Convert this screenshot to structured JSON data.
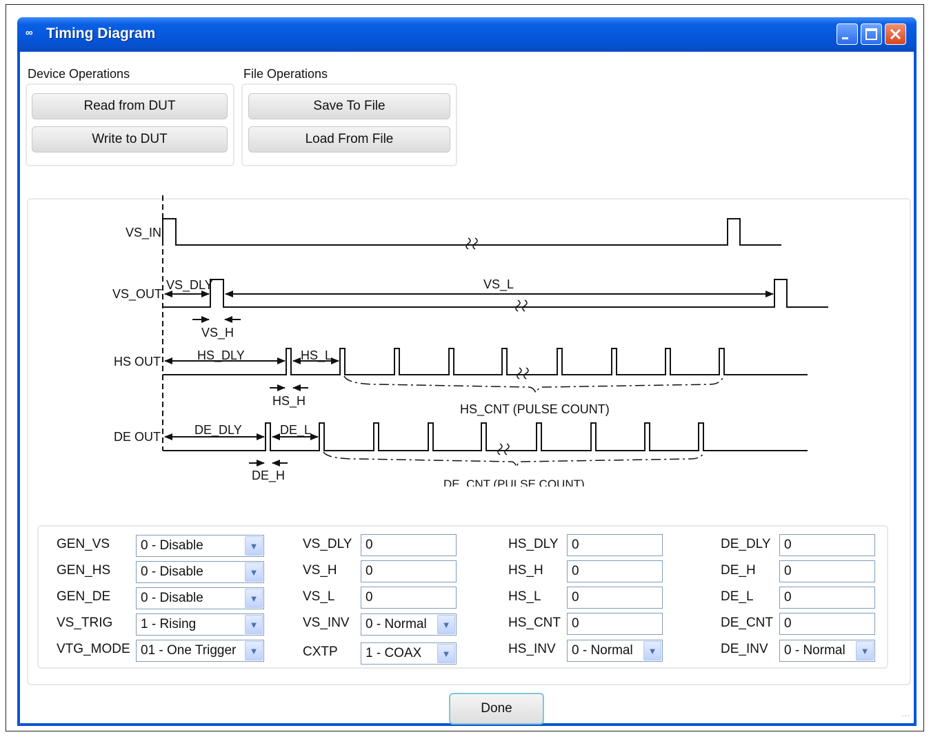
{
  "window": {
    "title": "Timing Diagram",
    "icon": "maxim-logo-icon"
  },
  "device_ops": {
    "label": "Device Operations",
    "read": "Read from DUT",
    "write": "Write to DUT"
  },
  "file_ops": {
    "label": "File Operations",
    "save": "Save To File",
    "load": "Load From File"
  },
  "diagram": {
    "signals": [
      "VS_IN",
      "VS_OUT",
      "HS OUT",
      "DE OUT"
    ],
    "labels": {
      "vs_dly": "VS_DLY",
      "vs_l": "VS_L",
      "vs_h": "VS_H",
      "hs_dly": "HS_DLY",
      "hs_l": "HS_L",
      "hs_h": "HS_H",
      "hs_cnt": "HS_CNT (PULSE COUNT)",
      "de_dly": "DE_DLY",
      "de_l": "DE_L",
      "de_h": "DE_H",
      "de_cnt": "DE_CNT (PULSE COUNT)"
    }
  },
  "params": {
    "col1": [
      {
        "label": "GEN_VS",
        "value": "0 - Disable"
      },
      {
        "label": "GEN_HS",
        "value": "0 - Disable"
      },
      {
        "label": "GEN_DE",
        "value": "0 - Disable"
      },
      {
        "label": "VS_TRIG",
        "value": "1 - Rising"
      },
      {
        "label": "VTG_MODE",
        "value": "01 - One Trigger"
      }
    ],
    "col2": [
      {
        "label": "VS_DLY",
        "value": "0"
      },
      {
        "label": "VS_H",
        "value": "0"
      },
      {
        "label": "VS_L",
        "value": "0"
      },
      {
        "label": "VS_INV",
        "value": "0 - Normal"
      },
      {
        "label": "CXTP",
        "value": "1 - COAX"
      }
    ],
    "col3": [
      {
        "label": "HS_DLY",
        "value": "0"
      },
      {
        "label": "HS_H",
        "value": "0"
      },
      {
        "label": "HS_L",
        "value": "0"
      },
      {
        "label": "HS_CNT",
        "value": "0"
      },
      {
        "label": "HS_INV",
        "value": "0 - Normal"
      }
    ],
    "col4": [
      {
        "label": "DE_DLY",
        "value": "0"
      },
      {
        "label": "DE_H",
        "value": "0"
      },
      {
        "label": "DE_L",
        "value": "0"
      },
      {
        "label": "DE_CNT",
        "value": "0"
      },
      {
        "label": "DE_INV",
        "value": "0 - Normal"
      }
    ]
  },
  "done": "Done"
}
